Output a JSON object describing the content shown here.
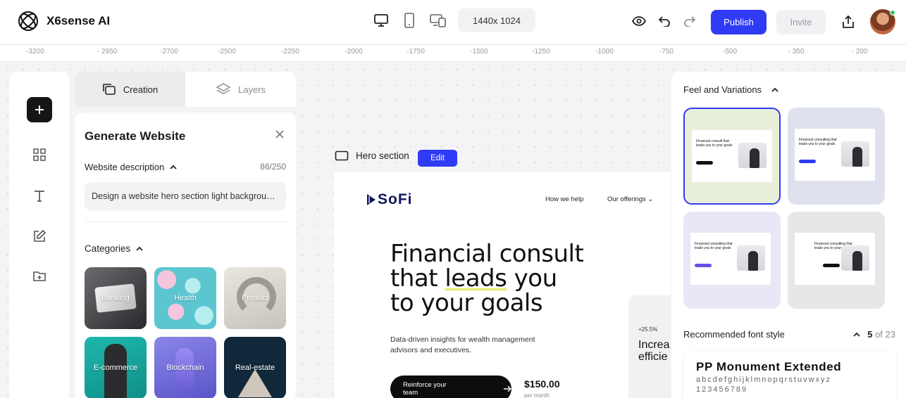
{
  "app": {
    "title": "X6sense AI"
  },
  "toolbar": {
    "canvas_size": "1440x 1024",
    "publish_label": "Publish",
    "invite_label": "Invite"
  },
  "ruler": {
    "ticks": [
      "-3200",
      "- 2950",
      "-2700",
      "-2500",
      "-2250",
      "-2000",
      "-1750",
      "-1500",
      "-1250",
      "-1000",
      "-750",
      "-500",
      "- 350",
      "- 200"
    ]
  },
  "left_tabs": {
    "creation": "Creation",
    "layers": "Layers"
  },
  "generate": {
    "title": "Generate Website",
    "description_label": "Website description",
    "description_count": "86/250",
    "description_value": "Design a website hero section light background with modern layout",
    "categories_label": "Categories",
    "categories": [
      "Banking",
      "Health",
      "Product",
      "E-commerce",
      "Blockchain",
      "Real-estate"
    ]
  },
  "frame": {
    "label": "Hero section",
    "edit_label": "Edit",
    "logo": "SoFi",
    "nav": [
      "How we help",
      "Our offerings"
    ],
    "headline_1": "Financial consult",
    "headline_2a": "that ",
    "headline_2b": "leads",
    "headline_2c": " you",
    "headline_3": "to your goals",
    "subtitle": "Data-driven insights for wealth management advisors and executives.",
    "cta": "Reinforce your team",
    "price": "$150.00",
    "price_sub": "per month"
  },
  "side_card": {
    "pct": "+25.5%",
    "text": "Increa comp efficie"
  },
  "variations": {
    "title": "Feel and Variations",
    "items": [
      {
        "text": "Financial consult that leads you to your goals",
        "bg": "#e8efd8"
      },
      {
        "text": "Financial consulting that leads you to your goals",
        "bg": "#dfe2ee"
      },
      {
        "text": "Financial consulting that leads you to your goals",
        "bg": "#e9e6f6"
      },
      {
        "text": "Financial consulting that leads you to your goals",
        "bg": "#e7e7ea"
      }
    ]
  },
  "font_style": {
    "title": "Recommended font style",
    "page": "5",
    "of": "of 23",
    "font_name": "PP Monument Extended",
    "alphabet": "abcdefghijklmnopqrstuvwxyz",
    "digits": "123456789"
  },
  "colors": {
    "accent": "#2f3bf5",
    "dark": "#151518",
    "highlight": "#e6ec6a"
  }
}
